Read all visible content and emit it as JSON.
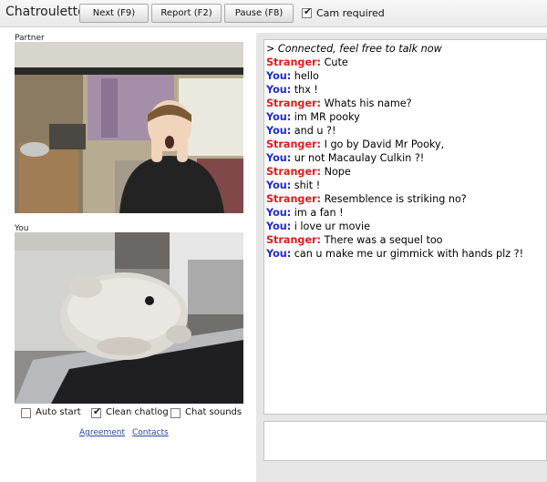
{
  "app": {
    "title": "Chatroulette"
  },
  "toolbar": {
    "next_label": "Next (F9)",
    "report_label": "Report (F2)",
    "pause_label": "Pause (F8)",
    "cam_required_label": "Cam required",
    "cam_required_checked": true
  },
  "partner": {
    "label": "Partner"
  },
  "you": {
    "label": "You"
  },
  "options": {
    "auto_start_label": "Auto start",
    "auto_start_checked": false,
    "clean_chatlog_label": "Clean chatlog",
    "clean_chatlog_checked": true,
    "chat_sounds_label": "Chat sounds",
    "chat_sounds_checked": false
  },
  "links": {
    "agreement": "Agreement",
    "contacts": "Contacts"
  },
  "chat": {
    "notice": "> Connected, feel free to talk now",
    "messages": [
      {
        "speaker": "Stranger:",
        "text": " Cute"
      },
      {
        "speaker": "You:",
        "text": " hello"
      },
      {
        "speaker": "You:",
        "text": " thx !"
      },
      {
        "speaker": "Stranger:",
        "text": " Whats his name?"
      },
      {
        "speaker": "You:",
        "text": " im MR pooky"
      },
      {
        "speaker": "You:",
        "text": " and u ?!"
      },
      {
        "speaker": "Stranger:",
        "text": " I go by David Mr Pooky,"
      },
      {
        "speaker": "You:",
        "text": " ur not Macaulay Culkin ?!"
      },
      {
        "speaker": "Stranger:",
        "text": " Nope"
      },
      {
        "speaker": "You:",
        "text": " shit !"
      },
      {
        "speaker": "Stranger:",
        "text": " Resemblence is striking no?"
      },
      {
        "speaker": "You:",
        "text": " im a fan !"
      },
      {
        "speaker": "You:",
        "text": " i love ur movie"
      },
      {
        "speaker": "Stranger:",
        "text": " There was a sequel too"
      },
      {
        "speaker": "You:",
        "text": " can u make me ur gimmick with hands plz ?!"
      }
    ]
  },
  "colors": {
    "stranger": "#e21b1b",
    "you": "#1e2ad6",
    "link": "#2a44a6"
  }
}
